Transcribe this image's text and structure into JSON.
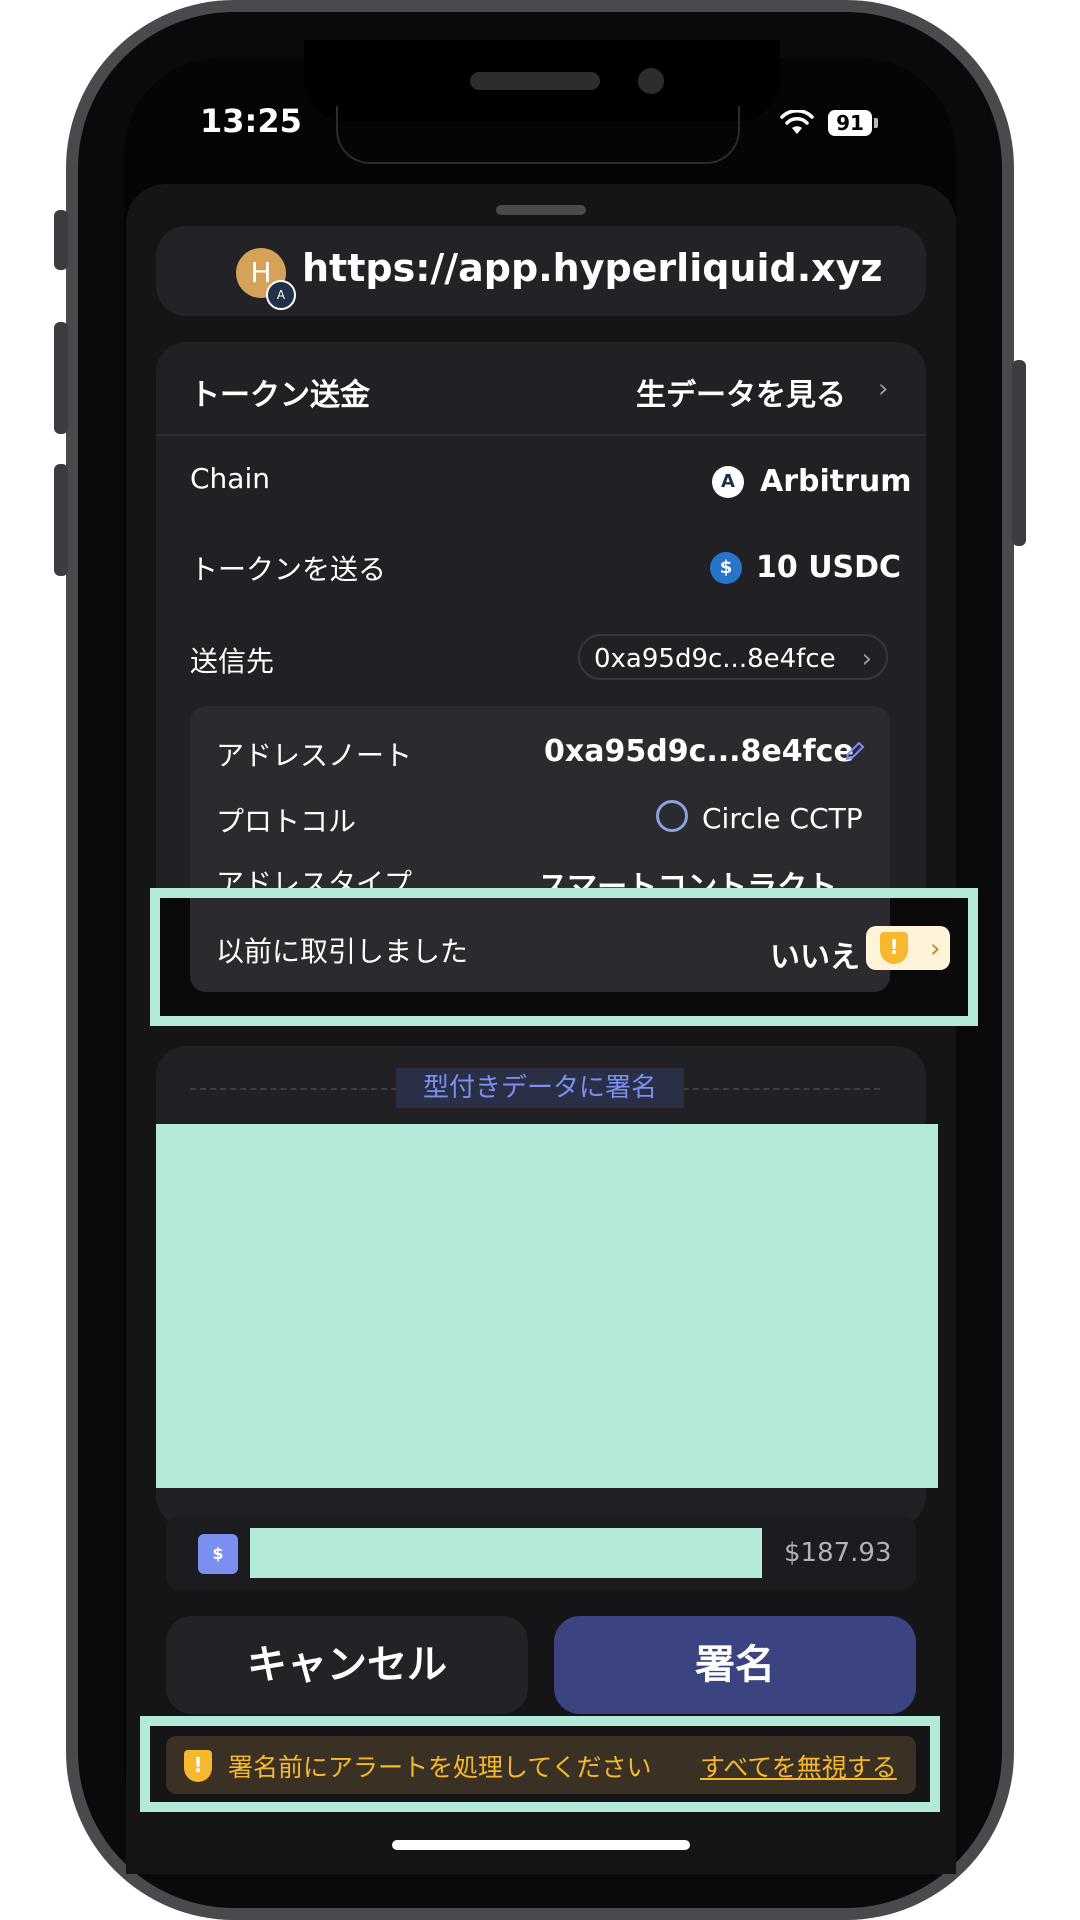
{
  "status_bar": {
    "time": "13:25",
    "battery": "91"
  },
  "site": {
    "avatar_letter": "H",
    "url": "https://app.hyperliquid.xyz"
  },
  "transaction": {
    "title": "トークン送金",
    "raw_data_link": "生データを見る",
    "chain_label": "Chain",
    "chain_value": "Arbitrum",
    "send_label": "トークンを送る",
    "send_value": "10 USDC",
    "recipient_label": "送信先",
    "recipient_value": "0xa95d9c...8e4fce",
    "details": {
      "address_note_label": "アドレスノート",
      "address_note_value": "0xa95d9c...8e4fce",
      "protocol_label": "プロトコル",
      "protocol_value": "Circle CCTP",
      "address_type_label": "アドレスタイプ",
      "address_type_value": "スマートコントラクト",
      "prev_tx_label": "以前に取引しました",
      "prev_tx_value": "いいえ"
    }
  },
  "typed_data": {
    "label": "型付きデータに署名"
  },
  "token_row": {
    "price": "$187.93"
  },
  "buttons": {
    "cancel": "キャンセル",
    "sign": "署名"
  },
  "warning": {
    "text": "署名前にアラートを処理してください",
    "ignore_all": "すべてを無視する"
  },
  "colors": {
    "accent": "#7b8ff0",
    "sign_button": "#3b4480",
    "warning": "#f5b82e",
    "highlight": "#b3eada"
  }
}
